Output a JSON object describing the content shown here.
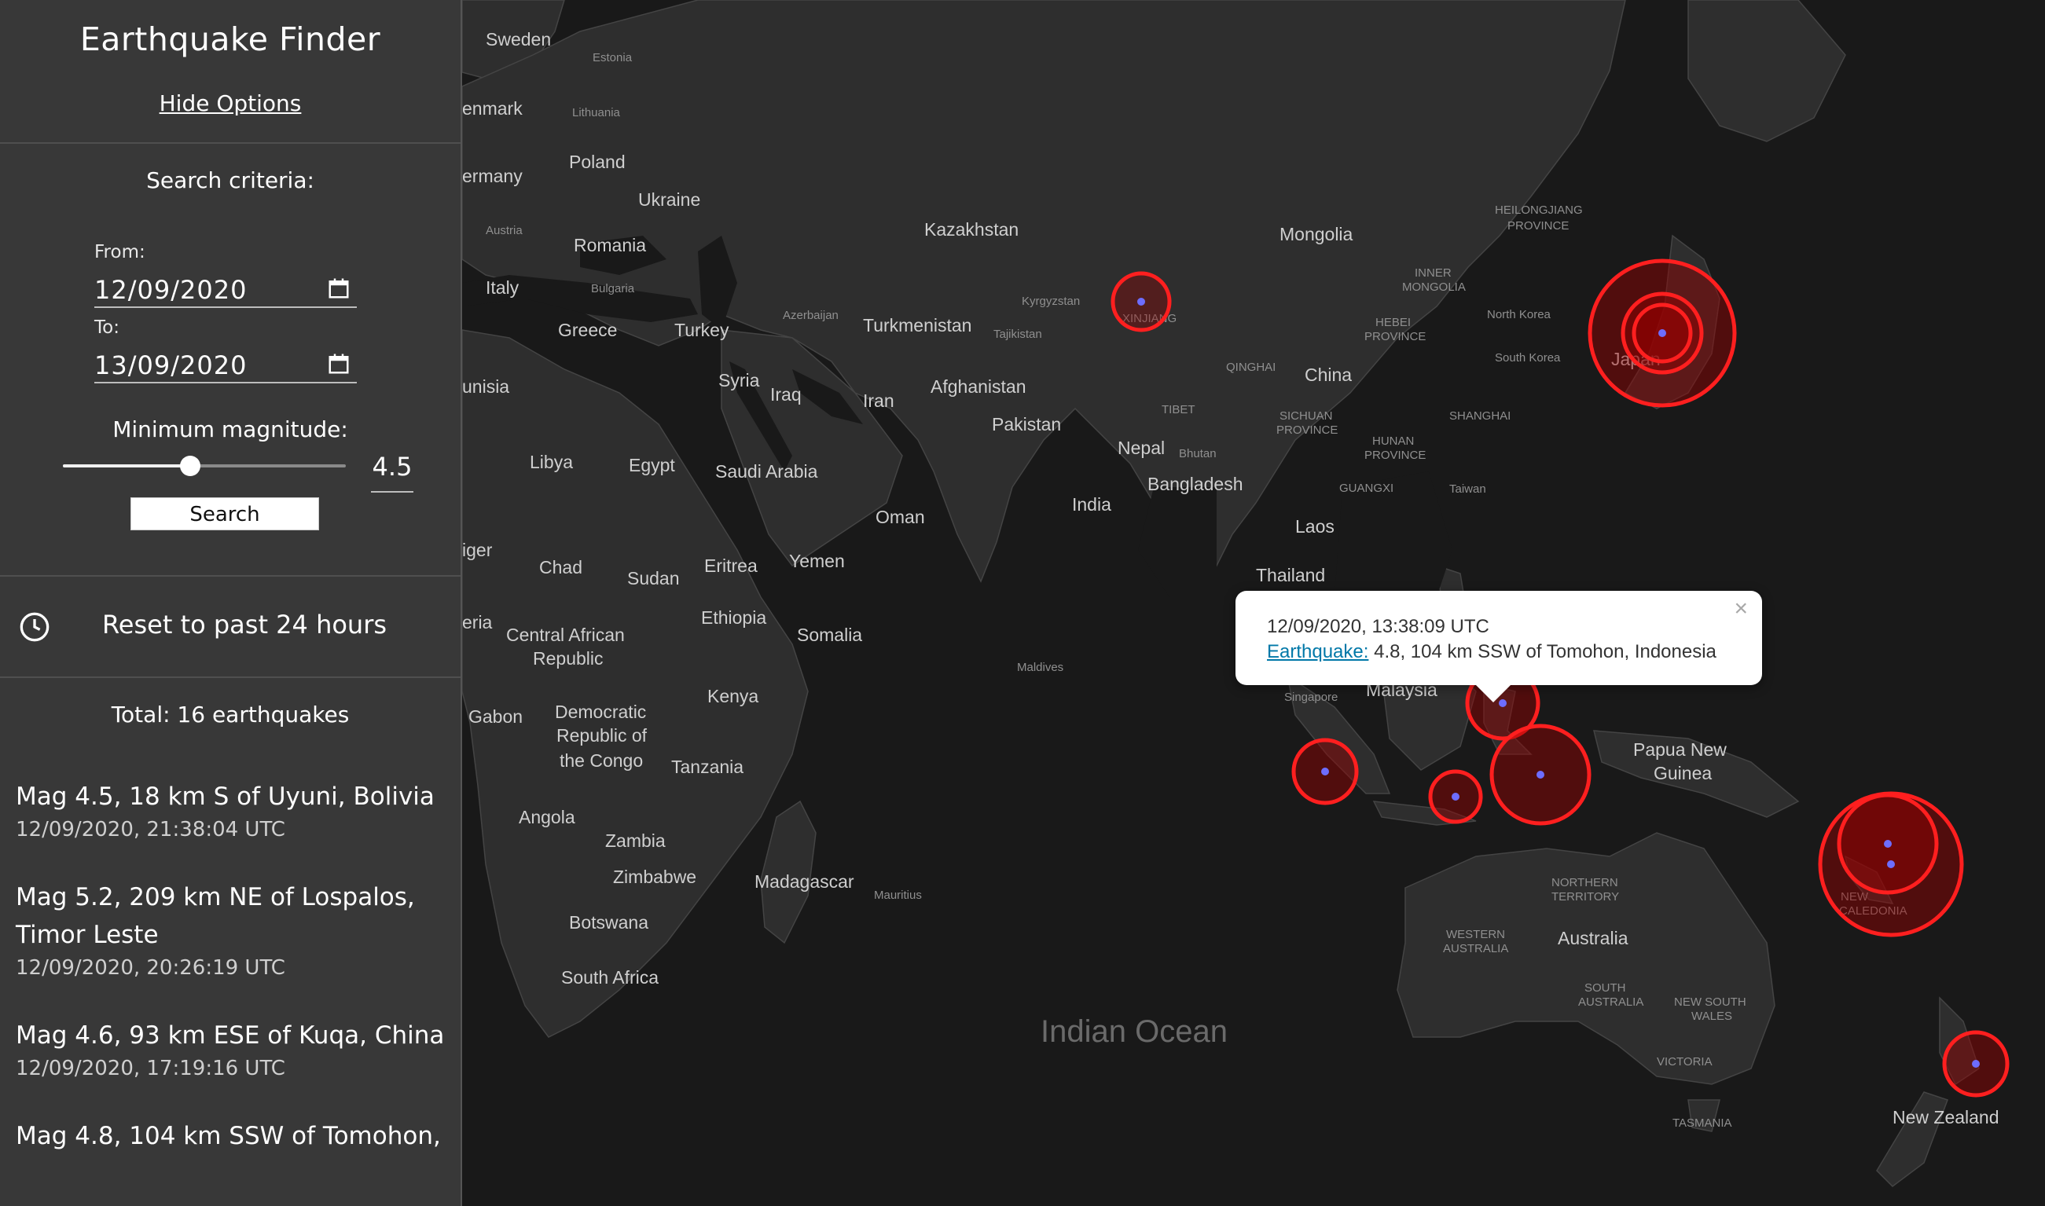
{
  "app": {
    "title": "Earthquake Finder",
    "hide_options": "Hide Options"
  },
  "search": {
    "criteria_label": "Search criteria:",
    "from_label": "From:",
    "from_value": "12/09/2020",
    "to_label": "To:",
    "to_value": "13/09/2020",
    "min_mag_label": "Minimum magnitude:",
    "min_mag_value": "4.5",
    "slider_level": 0.45,
    "search_button": "Search"
  },
  "reset": {
    "label": "Reset to past 24 hours"
  },
  "results": {
    "total": "Total: 16 earthquakes",
    "items": [
      {
        "title": "Mag 4.5, 18 km S of Uyuni, Bolivia",
        "time": "12/09/2020, 21:38:04 UTC"
      },
      {
        "title": "Mag 5.2, 209 km NE of Lospalos, Timor Leste",
        "time": "12/09/2020, 20:26:19 UTC"
      },
      {
        "title": "Mag 4.6, 93 km ESE of Kuqa, China",
        "time": "12/09/2020, 17:19:16 UTC"
      },
      {
        "title": "Mag 4.8, 104 km SSW of Tomohon,",
        "time": ""
      }
    ]
  },
  "popup": {
    "time": "12/09/2020, 13:38:09 UTC",
    "link": "Earthquake:",
    "description": " 4.8, 104 km SSW of Tomohon, Indonesia",
    "close": "×"
  },
  "map": {
    "country_labels": [
      "Sweden",
      "Estonia",
      "enmark",
      "Lithuania",
      "Poland",
      "ermany",
      "Ukraine",
      "Austria",
      "Romania",
      "Italy",
      "Bulgaria",
      "Greece",
      "Turkey",
      "Azerbaijan",
      "Turkmenistan",
      "Kazakhstan",
      "Kyrgyzstan",
      "Tajikistan",
      "Mongolia",
      "North Korea",
      "South Korea",
      "Japan",
      "China",
      "Syria",
      "Iraq",
      "Iran",
      "Afghanistan",
      "Pakistan",
      "Nepal",
      "Bhutan",
      "Bangladesh",
      "India",
      "Laos",
      "Thailand",
      "Taiwan",
      "unisia",
      "Libya",
      "Egypt",
      "Saudi Arabia",
      "Oman",
      "Yemen",
      "Eritrea",
      "Sudan",
      "Chad",
      "iger",
      "Ethiopia",
      "Somalia",
      "eria",
      "Central African",
      "Republic",
      "Kenya",
      "Gabon",
      "Democratic",
      "Republic of",
      "the Congo",
      "Tanzania",
      "Angola",
      "Zambia",
      "Zimbabwe",
      "Madagascar",
      "Botswana",
      "South Africa",
      "Malaysia",
      "Papua New",
      "Guinea",
      "Australia",
      "New Zealand"
    ],
    "region_labels": [
      "XINJIANG",
      "HEILONGJIANG",
      "PROVINCE",
      "INNER",
      "MONGOLIA",
      "HEBEI",
      "PROVINCE",
      "QINGHAI",
      "TIBET",
      "SICHUAN",
      "PROVINCE",
      "HUNAN",
      "PROVINCE",
      "SHANGHAI",
      "GUANGXI",
      "Maldives",
      "Singapore",
      "Mauritius",
      "NORTHERN",
      "TERRITORY",
      "WESTERN",
      "AUSTRALIA",
      "SOUTH",
      "AUSTRALIA",
      "NEW SOUTH",
      "WALES",
      "VICTORIA",
      "TASMANIA",
      "NEW",
      "CALEDONIA"
    ],
    "ocean_label": "Indian Ocean",
    "marker_color": "#ff1f1f",
    "marker_dot_color": "#6d6dff"
  }
}
